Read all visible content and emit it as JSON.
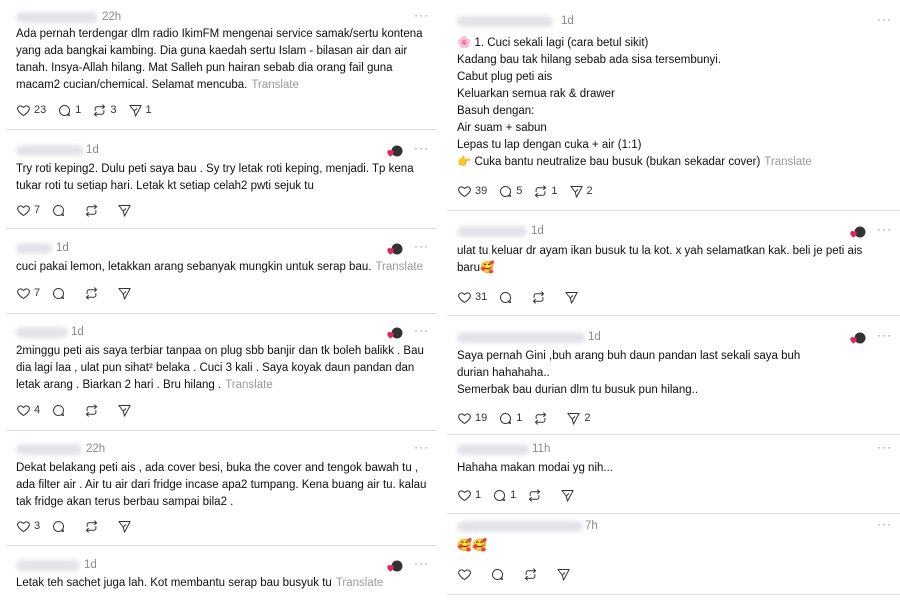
{
  "colors": {
    "border": "#dedede",
    "muted": "#8a8a8a",
    "text": "#0f0f0f",
    "heart": "#e0245e"
  },
  "left_posts": [
    {
      "time": "22h",
      "lines": [
        "Ada pernah terdengar dlm radio IkimFM mengenai service samak/sertu kontena",
        "yang ada bangkai kambing. Dia guna kaedah sertu Islam - bilasan air dan air",
        "tanah. Insya-Allah hilang. Mat Salleh pun hairan sebab dia orang fail guna",
        "macam2 cucian/chemical. Selamat mencuba."
      ],
      "translate": "Translate",
      "likes": "23",
      "replies": "1",
      "reposts": "3",
      "shares": "1"
    },
    {
      "time": "1d",
      "lines": [
        "Try roti keping2. Dulu peti saya bau . Sy try letak roti keping, menjadi. Tp kena",
        "tukar roti tu setiap hari. Letak kt setiap celah2 pwti sejuk tu"
      ],
      "likes": "7"
    },
    {
      "time": "1d",
      "lines": [
        "cuci pakai lemon, letakkan arang sebanyak mungkin untuk serap bau."
      ],
      "translate": "Translate",
      "likes": "7"
    },
    {
      "time": "1d",
      "lines": [
        "2minggu peti ais saya terbiar tanpaa on plug sbb banjir dan tk boleh balikk . Bau",
        "dia lagi laa , ulat pun sihat² belaka . Cuci 3 kali . Saya koyak daun pandan dan",
        "letak arang . Biarkan 2 hari . Bru hilang ."
      ],
      "translate": "Translate",
      "likes": "4"
    },
    {
      "time": "22h",
      "lines": [
        "Dekat belakang peti ais , ada cover besi, buka the cover and tengok bawah tu ,",
        "ada filter air . Air tu air dari fridge incase apa2 tumpang. Kena buang air tu. kalau",
        "tak fridge akan terus berbau sampai bila2 ."
      ],
      "likes": "3"
    },
    {
      "time": "1d",
      "lines": [
        "Letak teh sachet juga lah. Kot membantu serap bau busyuk tu"
      ],
      "translate": "Translate"
    }
  ],
  "right_posts": [
    {
      "time": "1d",
      "lines": [
        "🌸 1. Cuci sekali lagi (cara betul sikit)",
        "Kadang bau tak hilang sebab ada sisa tersembunyi.",
        "Cabut plug peti ais",
        "Keluarkan semua rak & drawer",
        "Basuh dengan:",
        "Air suam + sabun",
        "Lepas tu lap dengan cuka + air (1:1)",
        "👉 Cuka bantu neutralize bau busuk (bukan sekadar cover)"
      ],
      "translate": "Translate",
      "likes": "39",
      "replies": "5",
      "reposts": "1",
      "shares": "2"
    },
    {
      "time": "1d",
      "lines": [
        "ulat tu keluar dr ayam ikan busuk tu la kot. x yah selamatkan kak. beli je peti ais",
        "baru🥰"
      ],
      "likes": "31"
    },
    {
      "time": "1d",
      "lines": [
        "Saya pernah Gini ,buh arang buh daun pandan last sekali saya buh",
        "durian hahahaha..",
        "Semerbak bau durian dlm tu busuk pun hilang.."
      ],
      "likes": "19",
      "replies": "1",
      "shares": "2"
    },
    {
      "time": "11h",
      "lines": [
        "Hahaha makan modai yg nih..."
      ],
      "likes": "1",
      "replies": "1"
    },
    {
      "time": "7h",
      "lines": [
        "🥰🥰"
      ]
    }
  ]
}
